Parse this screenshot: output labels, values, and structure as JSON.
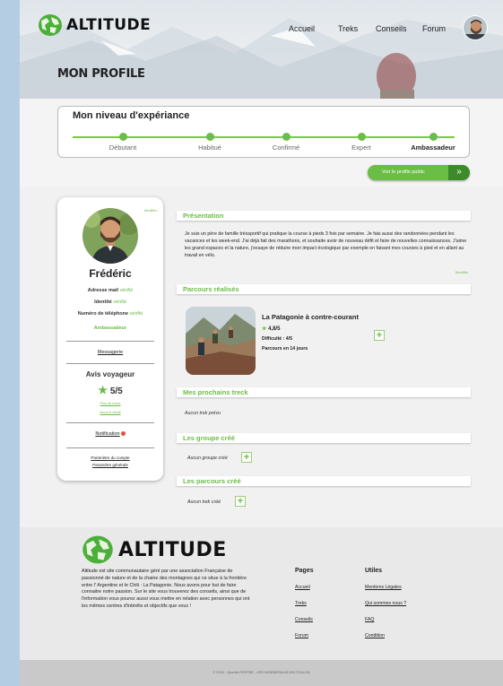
{
  "brand": {
    "name": "ALTITUDE"
  },
  "nav": {
    "items": [
      {
        "label": "Accueil"
      },
      {
        "label": "Treks"
      },
      {
        "label": "Conseils"
      },
      {
        "label": "Forum"
      }
    ]
  },
  "header": {
    "page_title": "MON PROFILE"
  },
  "level": {
    "title": "Mon niveau d'expériance",
    "steps": [
      "Débutant",
      "Habitué",
      "Confirmé",
      "Expert",
      "Ambassadeur"
    ],
    "current": "Ambassadeur"
  },
  "public_profile_button": {
    "label": "Voir le profile public",
    "icon": "double-chevron-right-icon"
  },
  "profile": {
    "edit_label": "Modifier",
    "name": "Frédéric",
    "email_label": "Adresse mail",
    "email_status": "vérifié",
    "identity_label": "Identité",
    "identity_status": "vérifié",
    "phone_label": "Numéro de téléphone",
    "phone_status": "vérifié",
    "rank": "Ambassadeur",
    "messaging": "Messagerie",
    "reviews_title": "Avis voyageur",
    "rating": "5/5",
    "see_more": "Plus de maux",
    "see_details": "Nous le détail",
    "notifications": "Notification",
    "account_settings": "Paramètre du compte",
    "general_settings": "Paramètre générale"
  },
  "presentation": {
    "title": "Présentation",
    "text": "Je suis un père de famille trèssportif qui pratique la course à pieds 3 fois par semaine. Je fais aussi des randonnées pendant les vacances et les week-end. J'ai déjà fait des marathons, et souhaite avoir de nouveau défit et faire de nouvelles connaissances. J'aime les grand espaces et la nature, j'essaye de réduire mon impact écologique par exemple en faisant mes courses à pied et en allant au travail en vélo.",
    "edit_label": "Modifier"
  },
  "parcours": {
    "title": "Parcours réalisés",
    "trek_title": "La Patagonie à contre-courant",
    "rating": "4,8/5",
    "difficulty": "Difficulté : 4/5",
    "duration": "Parcours en 14 jours"
  },
  "next_treks": {
    "title": "Mes prochains treck",
    "empty": "Aucun trek prévu"
  },
  "groups": {
    "title": "Les groupe créé",
    "empty": "Aucun groupe créé"
  },
  "created_parcours": {
    "title": "Les parcours créé",
    "empty": "Aucun trek créé"
  },
  "footer": {
    "description": "Altitude est site communautaire géré par une association Française de passionné de nature et de la chaine des montagnes qui ce situe à la frontière entre l' Argentine et le Chili : La Patagonie. Nous avons pour but de faire connaitre notre passion. Sur le site vous trouverez des conseils, ainsi que de l'information vous pourez aussi vous mettre en relation avec personnes qui ont les mêmes centres d'intérêts et objectifs que vous !",
    "pages_title": "Pages",
    "pages": [
      "Accueil",
      "Treks",
      "Conseils",
      "Forum"
    ],
    "utils_title": "Utiles",
    "utils": [
      "Mentions Légales",
      "Qui sommes nous ?",
      "FAQ",
      "Condition"
    ],
    "copyright": "© 2020 - Quentin PESTRE - UFR INGEMEDIA 83 000 TOULON"
  },
  "colors": {
    "accent": "#6abd45",
    "accent_dark": "#3c8a2a",
    "logo_green": "#4caf3a"
  }
}
